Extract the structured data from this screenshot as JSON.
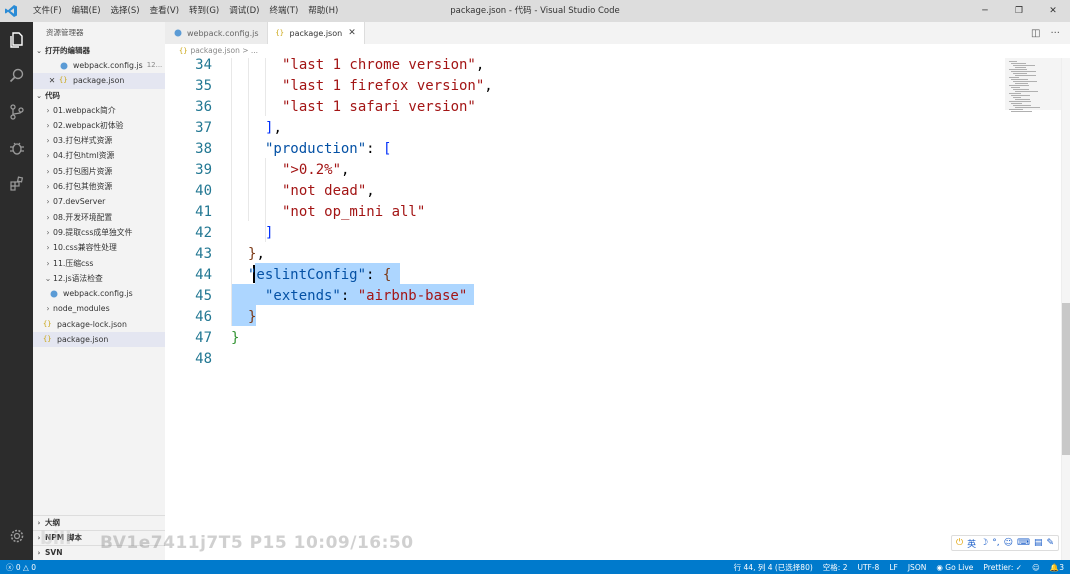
{
  "titlebar": {
    "menu": [
      "文件(F)",
      "编辑(E)",
      "选择(S)",
      "查看(V)",
      "转到(G)",
      "调试(D)",
      "终端(T)",
      "帮助(H)"
    ],
    "title": "package.json - 代码 - Visual Studio Code"
  },
  "sidebar": {
    "header": "资源管理器",
    "open_editors_label": "打开的编辑器",
    "open_editors": [
      {
        "name": "webpack.config.js",
        "hint": "12..."
      },
      {
        "name": "package.json"
      }
    ],
    "folder_label": "代码",
    "tree": [
      {
        "name": "01.webpack简介",
        "type": "folder"
      },
      {
        "name": "02.webpack初体验",
        "type": "folder"
      },
      {
        "name": "03.打包样式资源",
        "type": "folder"
      },
      {
        "name": "04.打包html资源",
        "type": "folder"
      },
      {
        "name": "05.打包图片资源",
        "type": "folder"
      },
      {
        "name": "06.打包其他资源",
        "type": "folder"
      },
      {
        "name": "07.devServer",
        "type": "folder"
      },
      {
        "name": "08.开发环境配置",
        "type": "folder"
      },
      {
        "name": "09.提取css成单独文件",
        "type": "folder"
      },
      {
        "name": "10.css兼容性处理",
        "type": "folder"
      },
      {
        "name": "11.压缩css",
        "type": "folder"
      },
      {
        "name": "12.js语法检查",
        "type": "folder-open"
      },
      {
        "name": "webpack.config.js",
        "type": "js"
      },
      {
        "name": "node_modules",
        "type": "folder"
      },
      {
        "name": "package-lock.json",
        "type": "json"
      },
      {
        "name": "package.json",
        "type": "json"
      }
    ],
    "bottom_sections": [
      "大纲",
      "NPM 脚本",
      "SVN"
    ]
  },
  "tabs": [
    {
      "label": "webpack.config.js",
      "active": false
    },
    {
      "label": "package.json",
      "active": true
    }
  ],
  "breadcrumb": "package.json > ...",
  "editor": {
    "lines": [
      {
        "n": "34",
        "tokens": [
          [
            "s",
            "\"last 1 chrome version\""
          ],
          [
            "p",
            ","
          ]
        ],
        "indent": 3
      },
      {
        "n": "35",
        "tokens": [
          [
            "s",
            "\"last 1 firefox version\""
          ],
          [
            "p",
            ","
          ]
        ],
        "indent": 3
      },
      {
        "n": "36",
        "tokens": [
          [
            "s",
            "\"last 1 safari version\""
          ]
        ],
        "indent": 3
      },
      {
        "n": "37",
        "tokens": [
          [
            "bk3",
            "]"
          ],
          [
            "p",
            ","
          ]
        ],
        "indent": 2
      },
      {
        "n": "38",
        "tokens": [
          [
            "k",
            "\"production\""
          ],
          [
            "p",
            ": "
          ],
          [
            "bk3",
            "["
          ]
        ],
        "indent": 2
      },
      {
        "n": "39",
        "tokens": [
          [
            "s",
            "\">0.2%\""
          ],
          [
            "p",
            ","
          ]
        ],
        "indent": 3
      },
      {
        "n": "40",
        "tokens": [
          [
            "s",
            "\"not dead\""
          ],
          [
            "p",
            ","
          ]
        ],
        "indent": 3
      },
      {
        "n": "41",
        "tokens": [
          [
            "s",
            "\"not op_mini all\""
          ]
        ],
        "indent": 3
      },
      {
        "n": "42",
        "tokens": [
          [
            "bk3",
            "]"
          ]
        ],
        "indent": 2
      },
      {
        "n": "43",
        "tokens": [
          [
            "bk2",
            "}"
          ],
          [
            "p",
            ","
          ]
        ],
        "indent": 1
      },
      {
        "n": "44",
        "tokens": [
          [
            "k",
            "\"eslintConfig\""
          ],
          [
            "p",
            ": "
          ],
          [
            "bk2",
            "{"
          ]
        ],
        "indent": 1
      },
      {
        "n": "45",
        "tokens": [
          [
            "k",
            "\"extends\""
          ],
          [
            "p",
            ": "
          ],
          [
            "s",
            "\"airbnb-base\""
          ]
        ],
        "indent": 2
      },
      {
        "n": "46",
        "tokens": [
          [
            "bk2",
            "}"
          ]
        ],
        "indent": 1
      },
      {
        "n": "47",
        "tokens": [
          [
            "bk",
            "}"
          ]
        ],
        "indent": 0
      },
      {
        "n": "48",
        "tokens": [],
        "indent": 0
      }
    ]
  },
  "watermark": "BV1e7411j7T5 P15 10:09/16:50",
  "ime": {
    "label": "英"
  },
  "statusbar": {
    "errors": "0",
    "warnings": "0",
    "position": "行 44, 列 4 (已选择80)",
    "spaces": "空格: 2",
    "encoding": "UTF-8",
    "eol": "LF",
    "language": "JSON",
    "golive": "Go Live",
    "prettier": "Prettier: ✓",
    "notifications": "3"
  },
  "colors": {
    "activitybar": "#2c2c2c",
    "statusbar": "#007acc",
    "selection": "#add6ff",
    "key": "#0451a5",
    "string": "#a31515",
    "linenumber": "#237893"
  }
}
